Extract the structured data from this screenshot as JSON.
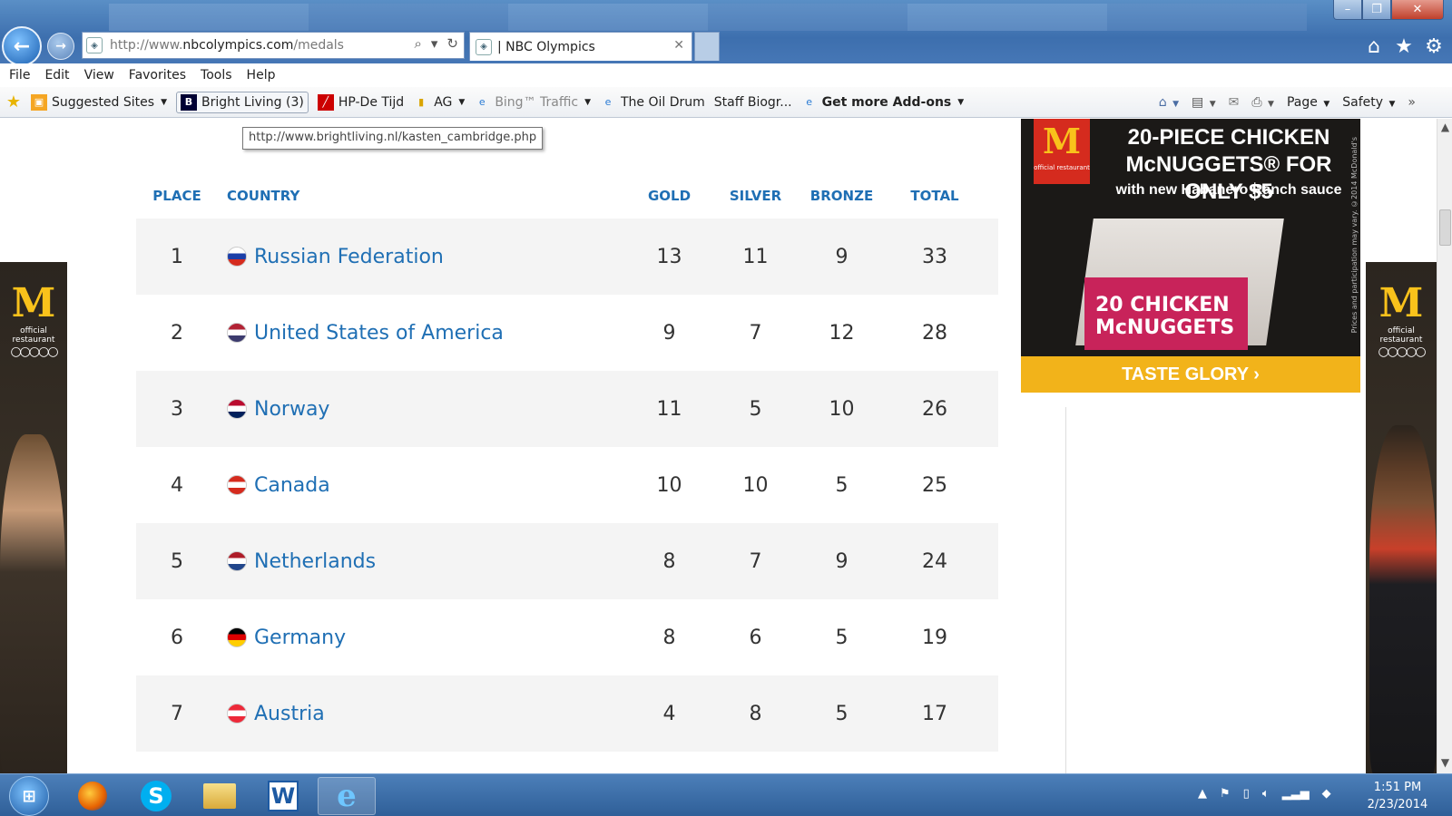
{
  "window": {
    "minimize": "–",
    "maximize": "❐",
    "close": "✕"
  },
  "address": {
    "prefix": "http://www.",
    "domain": "nbcolympics.com",
    "path": "/medals"
  },
  "tab": {
    "title": "| NBC Olympics",
    "close": "✕"
  },
  "menu": [
    "File",
    "Edit",
    "View",
    "Favorites",
    "Tools",
    "Help"
  ],
  "favorites": [
    {
      "label": "Suggested Sites",
      "dropdown": true
    },
    {
      "label": "Bright Living (3)",
      "dropdown": false
    },
    {
      "label": "HP-De Tijd",
      "dropdown": false
    },
    {
      "label": "AG",
      "dropdown": true
    },
    {
      "label": "Bing™ Traffic",
      "dropdown": true
    },
    {
      "label": "The Oil Drum",
      "dropdown": false
    },
    {
      "label": "Staff Biogr...",
      "dropdown": false
    },
    {
      "label": "Get more Add-ons",
      "dropdown": true
    }
  ],
  "commandbar": {
    "page": "Page",
    "safety": "Safety"
  },
  "tooltip": "http://www.brightliving.nl/kasten_cambridge.php",
  "table": {
    "headers": {
      "place": "PLACE",
      "country": "COUNTRY",
      "gold": "GOLD",
      "silver": "SILVER",
      "bronze": "BRONZE",
      "total": "TOTAL"
    },
    "rows": [
      {
        "place": "1",
        "country": "Russian Federation",
        "gold": "13",
        "silver": "11",
        "bronze": "9",
        "total": "33",
        "flag": [
          "#ffffff",
          "#1c3fa8",
          "#d52b1e"
        ]
      },
      {
        "place": "2",
        "country": "United States of America",
        "gold": "9",
        "silver": "7",
        "bronze": "12",
        "total": "28",
        "flag": [
          "#b22234",
          "#ffffff",
          "#3c3b6e"
        ]
      },
      {
        "place": "3",
        "country": "Norway",
        "gold": "11",
        "silver": "5",
        "bronze": "10",
        "total": "26",
        "flag": [
          "#ba0c2f",
          "#ffffff",
          "#00205b"
        ]
      },
      {
        "place": "4",
        "country": "Canada",
        "gold": "10",
        "silver": "10",
        "bronze": "5",
        "total": "25",
        "flag": [
          "#d52b1e",
          "#ffffff",
          "#d52b1e"
        ]
      },
      {
        "place": "5",
        "country": "Netherlands",
        "gold": "8",
        "silver": "7",
        "bronze": "9",
        "total": "24",
        "flag": [
          "#ae1c28",
          "#ffffff",
          "#21468b"
        ]
      },
      {
        "place": "6",
        "country": "Germany",
        "gold": "8",
        "silver": "6",
        "bronze": "5",
        "total": "19",
        "flag": [
          "#000000",
          "#dd0000",
          "#ffce00"
        ]
      },
      {
        "place": "7",
        "country": "Austria",
        "gold": "4",
        "silver": "8",
        "bronze": "5",
        "total": "17",
        "flag": [
          "#ed2939",
          "#ffffff",
          "#ed2939"
        ]
      }
    ]
  },
  "ad": {
    "logo": "M",
    "logo_sub": "official restaurant",
    "headline": "20-PIECE CHICKEN McNUGGETS® FOR ONLY $5",
    "subline": "with new Habanero Ranch sauce",
    "box_text": "20 CHICKEN McNUGGETS",
    "cta": "TASTE GLORY ›",
    "disclaimer": "Prices and participation may vary. ©2014 McDonald's"
  },
  "side_ad": {
    "logo": "M",
    "sub": "official restaurant",
    "rings": "○○○○○"
  },
  "taskbar": {
    "time": "1:51 PM",
    "date": "2/23/2014"
  }
}
